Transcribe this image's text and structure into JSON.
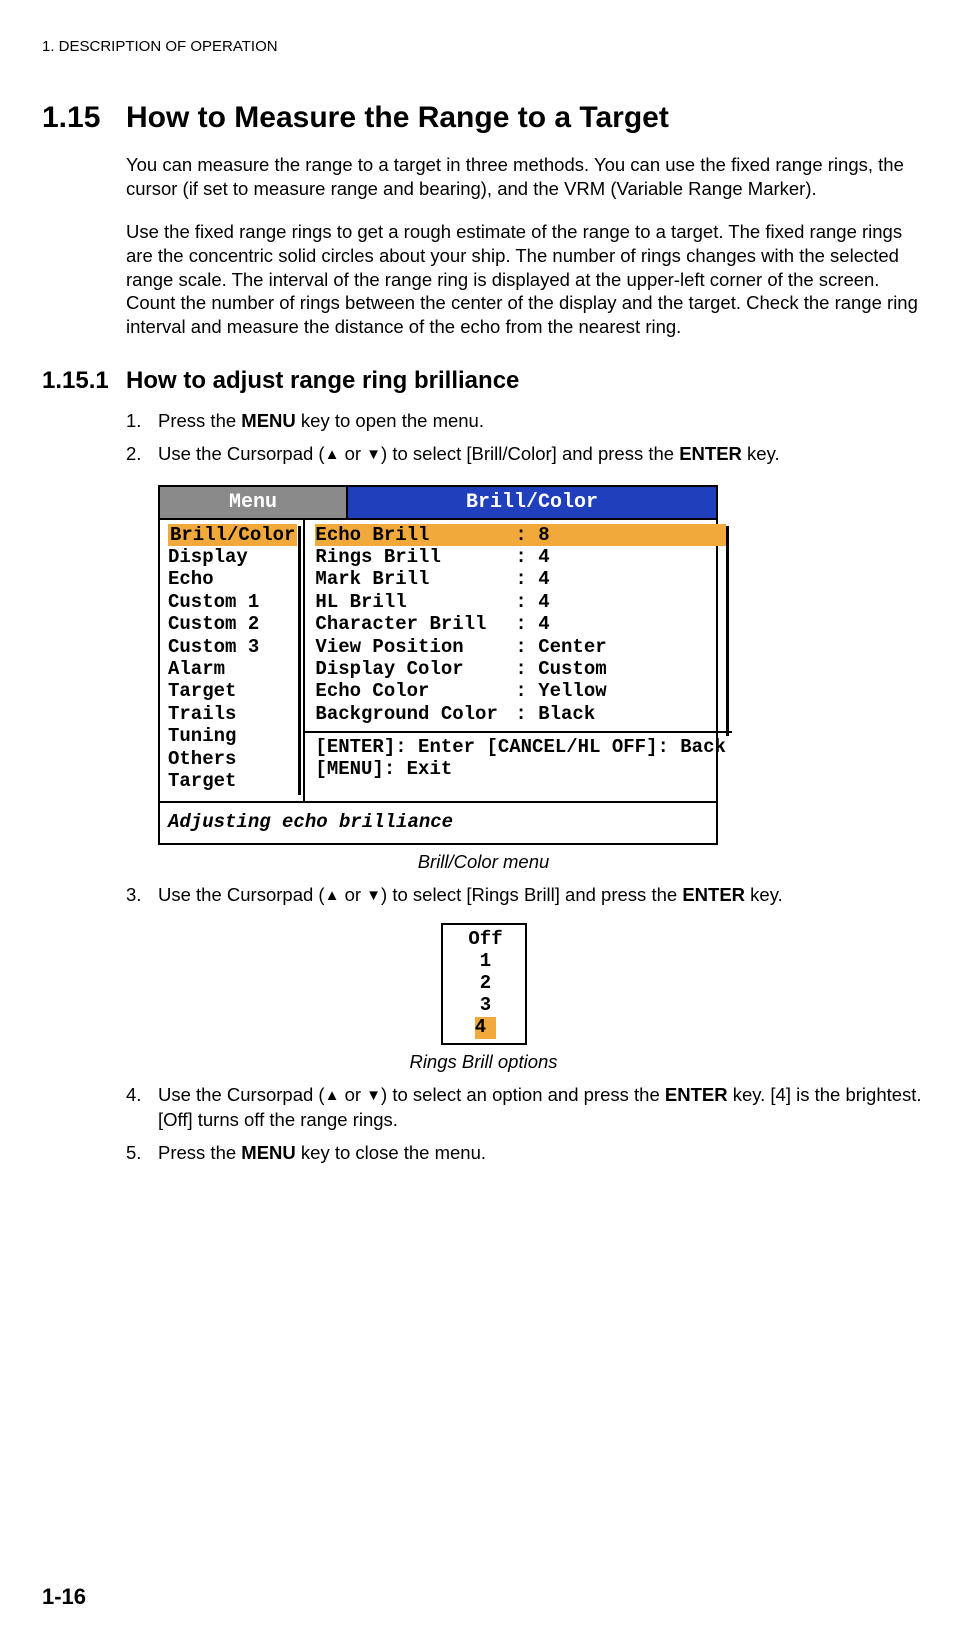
{
  "header": {
    "breadcrumb": "1.  DESCRIPTION OF OPERATION"
  },
  "section": {
    "num": "1.15",
    "title": "How to Measure the Range to a Target",
    "p1": "You can measure the range to a target in three methods. You can use the fixed range rings, the cursor (if set to measure range and bearing), and the VRM (Variable Range Marker).",
    "p2": "Use the fixed range rings to get a rough estimate of the range to a target. The fixed range rings are the concentric solid circles about your ship. The number of rings changes with the selected range scale. The interval of the range ring is displayed at the upper-left corner of the screen. Count the number of rings between the center of the display and the target. Check the range ring interval and measure the distance of the echo from the nearest ring."
  },
  "subsec": {
    "num": "1.15.1",
    "title": "How to adjust range ring brilliance"
  },
  "steps": {
    "s1_a": "Press the ",
    "s1_b": "MENU",
    "s1_c": " key to open the menu.",
    "s2_a": "Use the Cursorpad (",
    "s2_b": " or ",
    "s2_c": ") to select [Brill/Color] and press the ",
    "s2_d": "ENTER",
    "s2_e": " key.",
    "s3_a": "Use the Cursorpad (",
    "s3_b": " or ",
    "s3_c": ") to select [Rings Brill] and press the ",
    "s3_d": "ENTER",
    "s3_e": " key.",
    "s4_a": "Use the Cursorpad (",
    "s4_b": " or ",
    "s4_c": ") to select an option and press the ",
    "s4_d": "ENTER",
    "s4_e": " key. [4] is the brightest. [Off] turns off the range rings.",
    "s5_a": "Press the ",
    "s5_b": "MENU",
    "s5_c": " key to close the menu."
  },
  "menu": {
    "left_title": "Menu",
    "right_title": "Brill/Color",
    "left_items": [
      "Brill/Color",
      "Display",
      "Echo",
      "Custom 1",
      "Custom 2",
      "Custom 3",
      "Alarm",
      "Target Trails",
      "Tuning",
      "Others",
      "Target"
    ],
    "params": [
      {
        "lbl": "Echo Brill",
        "val": ": 8",
        "sel": true
      },
      {
        "lbl": "Rings Brill",
        "val": ": 4"
      },
      {
        "lbl": "Mark Brill",
        "val": ": 4"
      },
      {
        "lbl": "HL Brill",
        "val": ": 4"
      },
      {
        "lbl": "Character Brill",
        "val": ": 4"
      },
      {
        "lbl": "View Position",
        "val": ": Center"
      },
      {
        "lbl": "Display Color",
        "val": ": Custom"
      },
      {
        "lbl": "Echo Color",
        "val": ": Yellow"
      },
      {
        "lbl": "Background Color",
        "val": ": Black"
      }
    ],
    "hints_l1": "[ENTER]: Enter [CANCEL/HL OFF]: Back",
    "hints_l2": "[MENU]: Exit",
    "footer": "Adjusting echo brilliance"
  },
  "fig1_caption": "Brill/Color menu",
  "opts": {
    "items": [
      "Off",
      "1",
      "2",
      "3",
      "4"
    ],
    "sel_index": 4
  },
  "fig2_caption": "Rings Brill options",
  "page_num": "1-16"
}
